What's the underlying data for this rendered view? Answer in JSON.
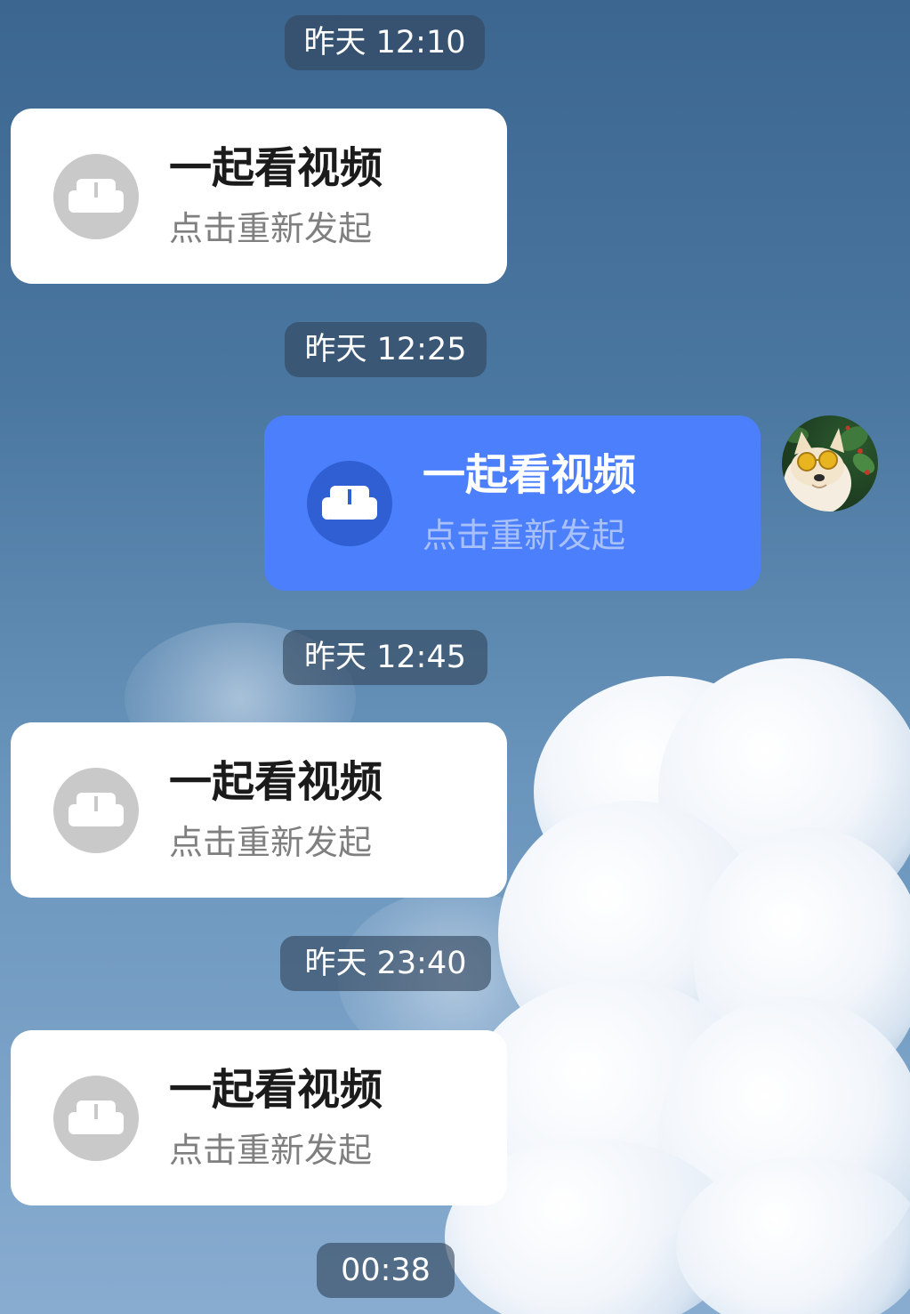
{
  "messages": [
    {
      "timestamp": "昨天 12:10",
      "card": {
        "direction": "incoming",
        "title": "一起看视频",
        "subtitle": "点击重新发起",
        "icon": "sofa-icon"
      }
    },
    {
      "timestamp": "昨天 12:25",
      "card": {
        "direction": "outgoing",
        "title": "一起看视频",
        "subtitle": "点击重新发起",
        "icon": "sofa-icon"
      }
    },
    {
      "timestamp": "昨天 12:45",
      "card": {
        "direction": "incoming",
        "title": "一起看视频",
        "subtitle": "点击重新发起",
        "icon": "sofa-icon"
      }
    },
    {
      "timestamp": "昨天 23:40",
      "card": {
        "direction": "incoming",
        "title": "一起看视频",
        "subtitle": "点击重新发起",
        "icon": "sofa-icon"
      }
    },
    {
      "timestamp": "00:38"
    }
  ],
  "avatar": {
    "icon": "dog-with-sunglasses-avatar"
  },
  "colors": {
    "outgoing_card": "#4c7ffc",
    "incoming_card": "#ffffff",
    "incoming_icon_bg": "#c9c9c9",
    "outgoing_icon_bg": "#2f5fd2"
  }
}
